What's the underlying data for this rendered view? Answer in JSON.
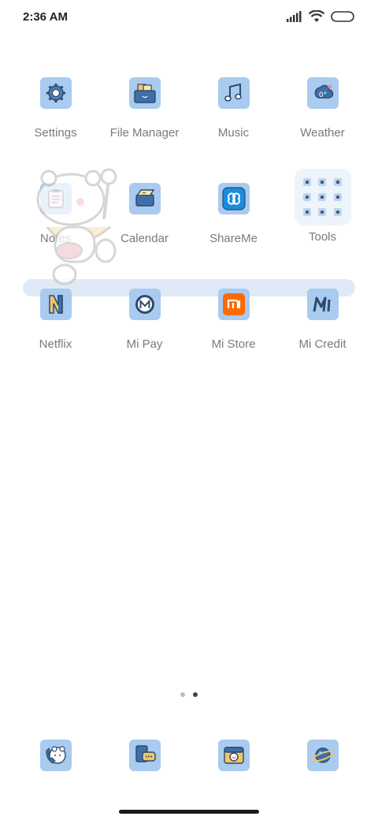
{
  "status_bar": {
    "time": "2:36 AM"
  },
  "apps": [
    {
      "label": "Settings",
      "icon": "gear-icon"
    },
    {
      "label": "File Manager",
      "icon": "folder-icon"
    },
    {
      "label": "Music",
      "icon": "music-note-icon"
    },
    {
      "label": "Weather",
      "icon": "weather-icon"
    },
    {
      "label": "Notes",
      "icon": "notes-icon"
    },
    {
      "label": "Calendar",
      "icon": "calendar-icon"
    },
    {
      "label": "ShareMe",
      "icon": "infinity-icon"
    },
    {
      "label": "Tools",
      "icon": "tools-folder-icon"
    },
    {
      "label": "Netflix",
      "icon": "netflix-n-icon"
    },
    {
      "label": "Mi Pay",
      "icon": "mi-pay-icon"
    },
    {
      "label": "Mi Store",
      "icon": "mi-store-icon"
    },
    {
      "label": "Mi Credit",
      "icon": "mi-credit-icon"
    }
  ],
  "dock": [
    {
      "icon": "phone-icon"
    },
    {
      "icon": "messages-icon"
    },
    {
      "icon": "camera-icon"
    },
    {
      "icon": "browser-planet-icon"
    }
  ],
  "page_indicator": {
    "pages": 2,
    "current": 2
  },
  "colors": {
    "icon_bg": "#a9cbef",
    "icon_stroke": "#2f4a6b",
    "accent_orange": "#ff6a00",
    "accent_blue": "#1a8ce0"
  }
}
